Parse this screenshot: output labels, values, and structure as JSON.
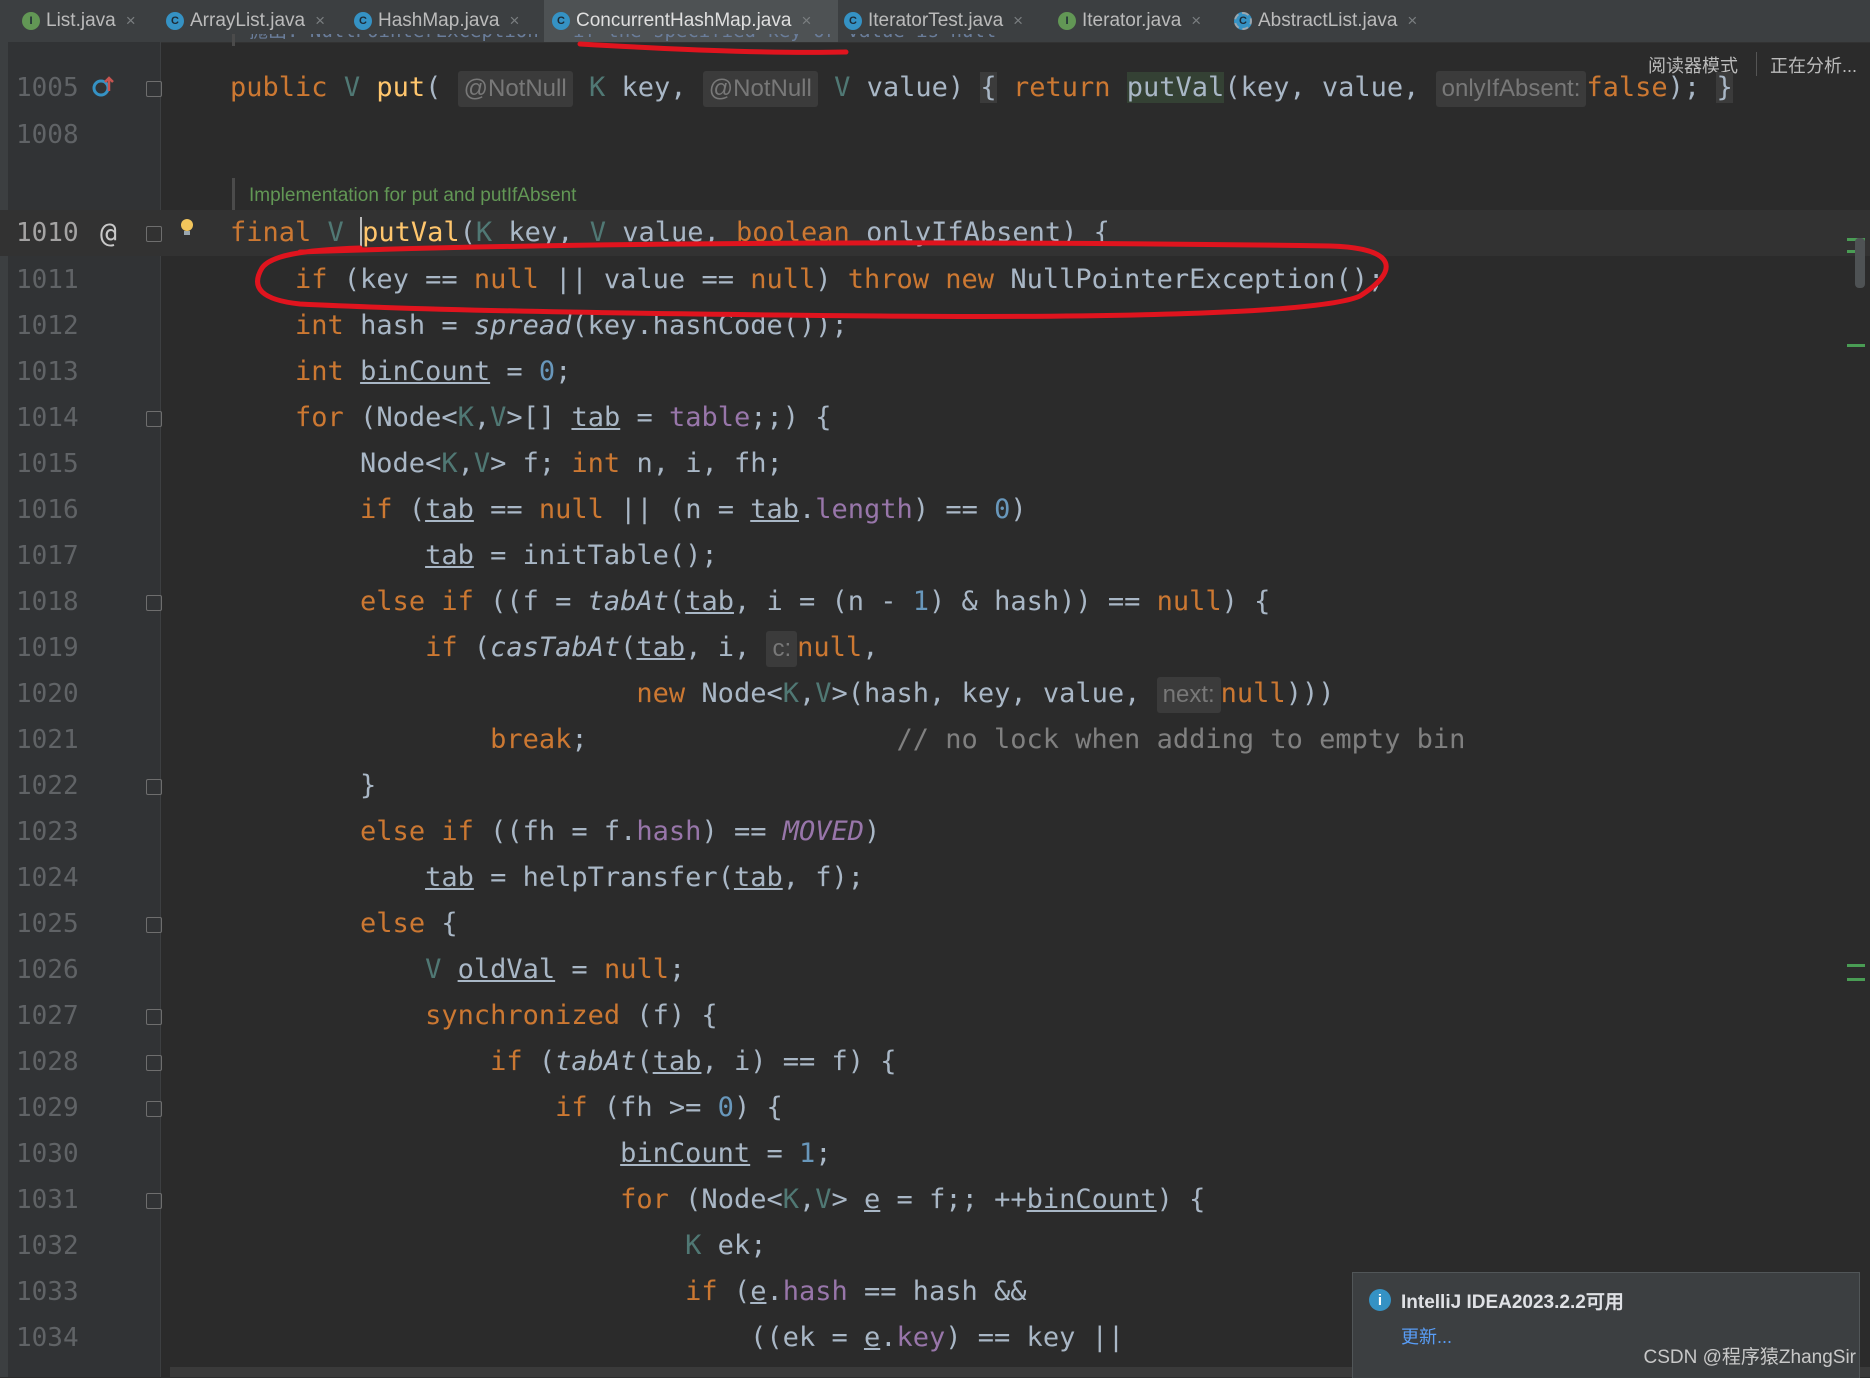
{
  "tabs": [
    {
      "label": "List.java",
      "icon": "interface-icon"
    },
    {
      "label": "ArrayList.java",
      "icon": "class-icon"
    },
    {
      "label": "HashMap.java",
      "icon": "class-icon"
    },
    {
      "label": "ConcurrentHashMap.java",
      "icon": "class-icon",
      "active": true
    },
    {
      "label": "IteratorTest.java",
      "icon": "class-icon"
    },
    {
      "label": "Iterator.java",
      "icon": "interface-icon"
    },
    {
      "label": "AbstractList.java",
      "icon": "abstract-class-icon"
    }
  ],
  "toolbar": {
    "reader_mode": "阅读器模式",
    "analyzing": "正在分析..."
  },
  "doc_comment": "Implementation for put and putIfAbsent",
  "top_partial": "抛出: NullPointerException – if the specified key or value is null",
  "line_numbers": [
    "1005",
    "1008",
    "1010",
    "1011",
    "1012",
    "1013",
    "1014",
    "1015",
    "1016",
    "1017",
    "1018",
    "1019",
    "1020",
    "1021",
    "1022",
    "1023",
    "1024",
    "1025",
    "1026",
    "1027",
    "1028",
    "1029",
    "1030",
    "1031",
    "1032",
    "1033",
    "1034"
  ],
  "hints": {
    "not_null": "@NotNull",
    "only_if_absent": "onlyIfAbsent:",
    "c": "c:",
    "next": "next:"
  },
  "comment_text": "// no lock when adding to empty bin",
  "notification": {
    "title": "IntelliJ IDEA2023.2.2可用",
    "link": "更新..."
  },
  "watermark": "CSDN @程序猿ZhangSir",
  "colors": {
    "background": "#2b2b2b",
    "keyword": "#cc7832",
    "annotation": "#e0141e"
  }
}
